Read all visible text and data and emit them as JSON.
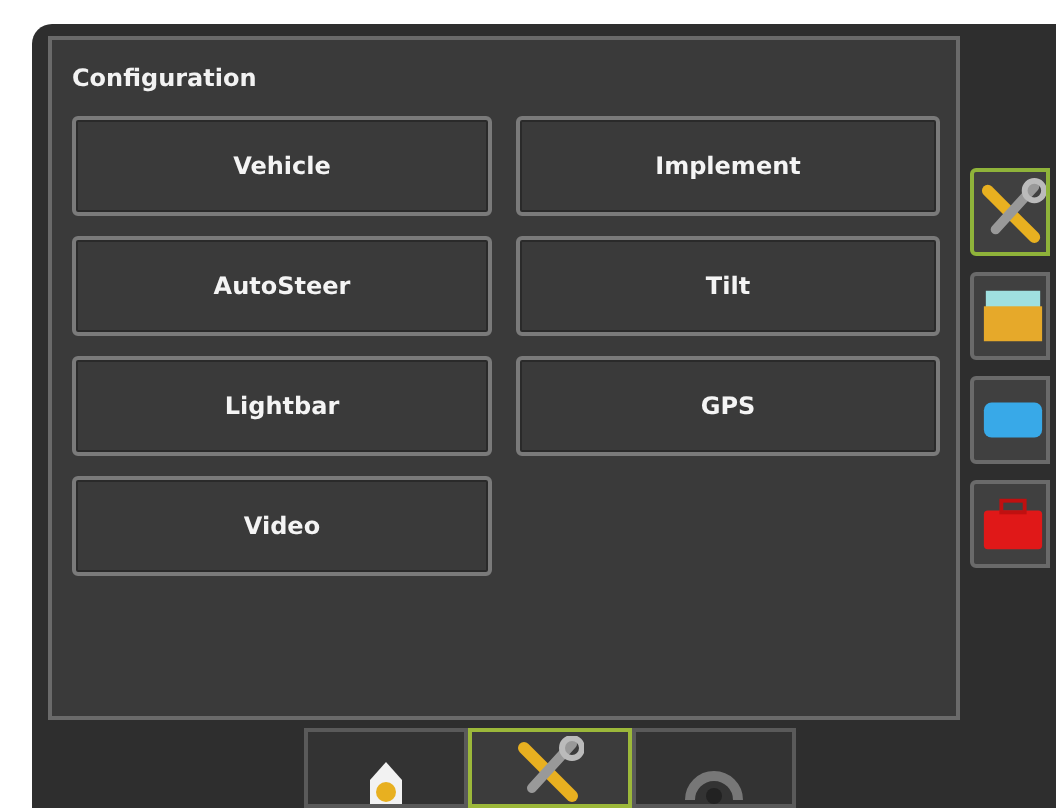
{
  "panel": {
    "title": "Configuration",
    "buttons": [
      "Vehicle",
      "Implement",
      "AutoSteer",
      "Tilt",
      "Lightbar",
      "GPS",
      "Video"
    ]
  },
  "side_tabs": [
    {
      "kind": "tools",
      "selected": true
    },
    {
      "kind": "folder",
      "selected": false
    },
    {
      "kind": "screen",
      "selected": false
    },
    {
      "kind": "toolbox",
      "selected": false
    }
  ],
  "bottom_tabs": [
    {
      "kind": "home",
      "selected": false
    },
    {
      "kind": "tools",
      "selected": true
    },
    {
      "kind": "gauge",
      "selected": false
    }
  ]
}
